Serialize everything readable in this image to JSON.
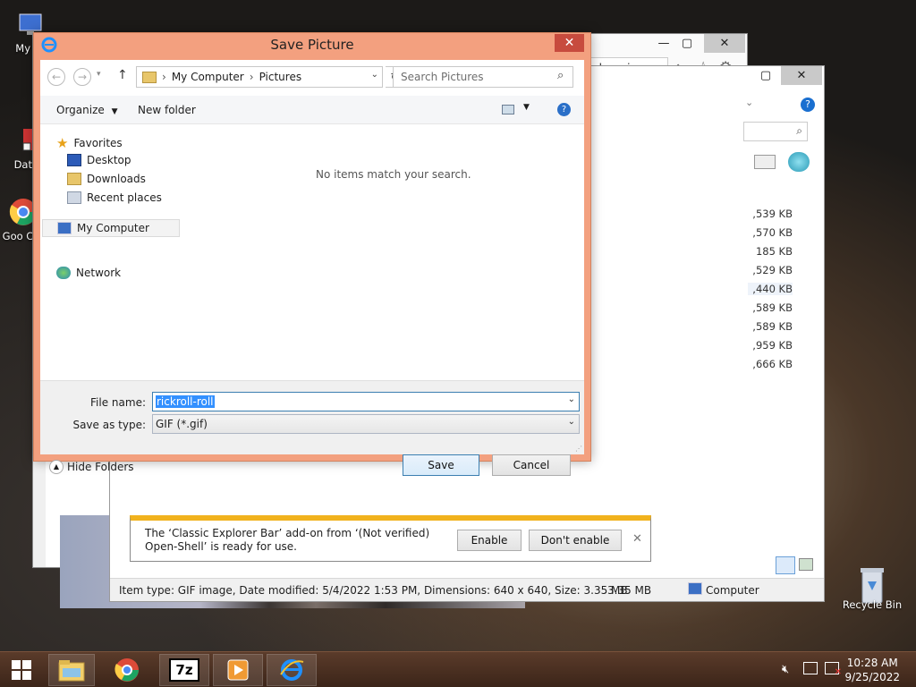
{
  "desktop": {
    "icons": [
      {
        "label": "My Co"
      },
      {
        "label": "DataW"
      },
      {
        "label": "Goo Chr"
      },
      {
        "label": "Recycle Bin"
      }
    ]
  },
  "ie": {
    "tab_title": "plorer is ...",
    "notification": {
      "message_line1": "The ‘Classic Explorer Bar’ add-on from ‘(Not verified)",
      "message_line2": "Open-Shell’ is ready for use.",
      "enable_label": "Enable",
      "dont_enable_label": "Don't enable"
    }
  },
  "explorer_bg": {
    "sizes": [
      ",539 KB",
      ",570 KB",
      "185 KB",
      ",529 KB",
      ",440 KB",
      ",589 KB",
      ",589 KB",
      ",959 KB",
      ",666 KB"
    ],
    "status_text": "Item type: GIF image, Date modified: 5/4/2022 1:53 PM, Dimensions: 640 x 640, Size: 3.35 MB",
    "status_size": "3.35 MB",
    "status_location": "Computer"
  },
  "dialog": {
    "title": "Save Picture",
    "breadcrumb": [
      "My Computer",
      "Pictures"
    ],
    "search_placeholder": "Search Pictures",
    "organize_label": "Organize",
    "new_folder_label": "New folder",
    "empty_message": "No items match your search.",
    "nav": {
      "favorites": "Favorites",
      "desktop": "Desktop",
      "downloads": "Downloads",
      "recent": "Recent places",
      "my_computer": "My Computer",
      "network": "Network"
    },
    "file_name_label": "File name:",
    "file_name_value": "rickroll-roll",
    "save_type_label": "Save as type:",
    "save_type_value": "GIF (*.gif)",
    "hide_folders_label": "Hide Folders",
    "save_label": "Save",
    "cancel_label": "Cancel"
  },
  "taskbar": {
    "time": "10:28 AM",
    "date": "9/25/2022",
    "seven_zip_label": "7z"
  }
}
